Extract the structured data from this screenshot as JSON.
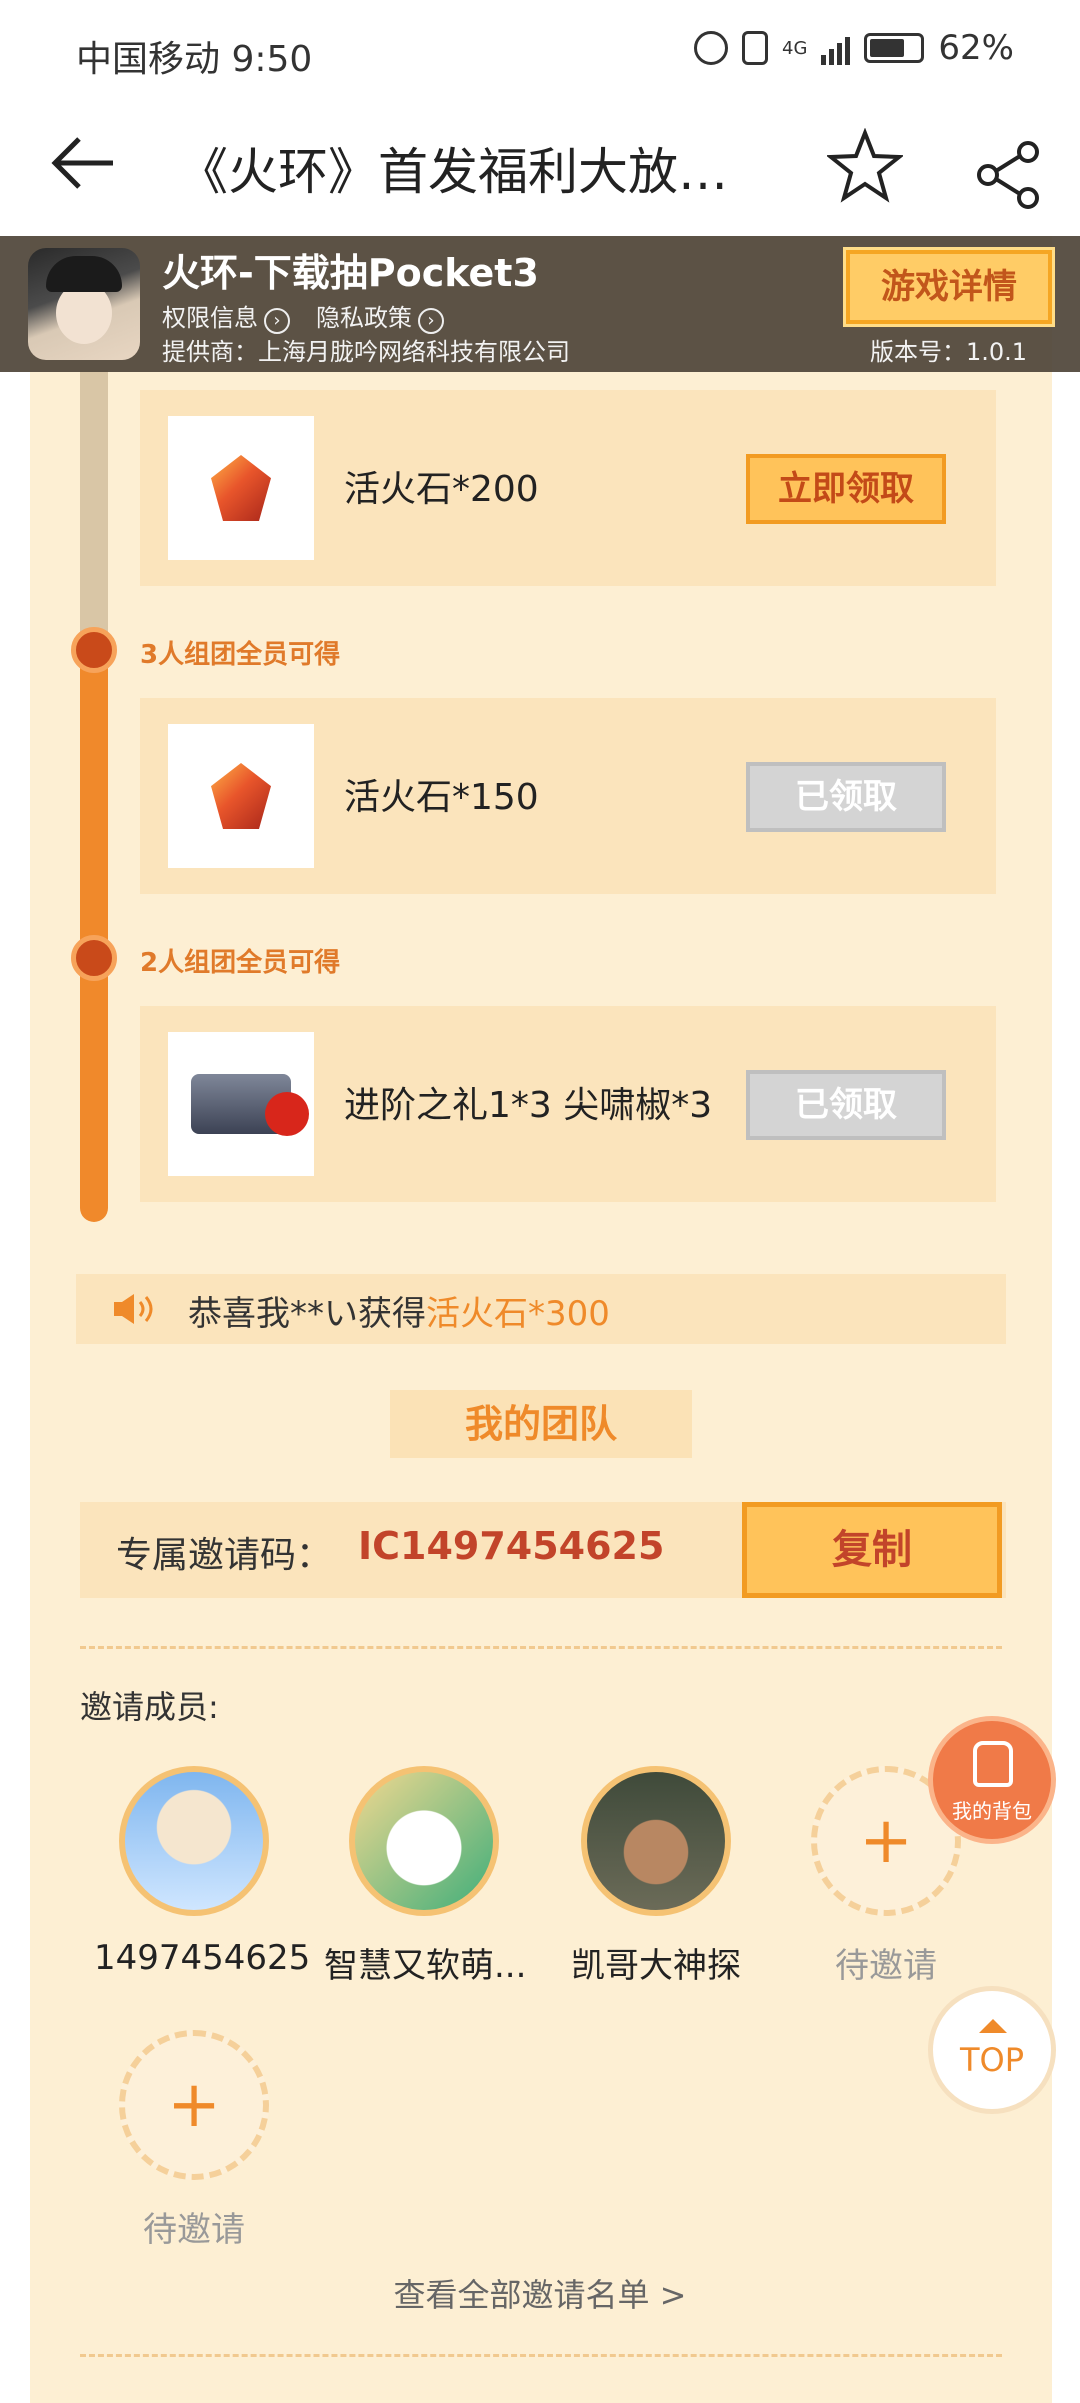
{
  "status_bar": {
    "carrier_time": "中国移动 9:50",
    "network": "4G",
    "battery": "62%"
  },
  "nav": {
    "title": "《火环》首发福利大放…"
  },
  "banner": {
    "game_name": "火环-下载抽Pocket3",
    "permission_link": "权限信息",
    "privacy_link": "隐私政策",
    "provider": "提供商：上海月胧吟网络科技有限公司",
    "detail_button": "游戏详情",
    "version": "版本号：1.0.1"
  },
  "rewards": [
    {
      "item": "活火石*200",
      "button": "立即领取",
      "state": "claimable"
    },
    {
      "tier": "3人组团全员可得",
      "item": "活火石*150",
      "button": "已领取",
      "state": "claimed"
    },
    {
      "tier": "2人组团全员可得",
      "item": "进阶之礼1*3   尖啸椒*3",
      "button": "已领取",
      "state": "claimed"
    }
  ],
  "broadcast": {
    "prefix": "恭喜我**い获得",
    "highlight": "活火石*300"
  },
  "team": {
    "title": "我的团队",
    "invite_label": "专属邀请码：",
    "invite_code": "IC1497454625",
    "copy_button": "复制",
    "members_title": "邀请成员:",
    "members": [
      {
        "name": "1497454625"
      },
      {
        "name": "智慧又软萌..."
      },
      {
        "name": "凯哥大神探"
      },
      {
        "name": "待邀请"
      },
      {
        "name": "待邀请"
      }
    ],
    "add_symbol": "+",
    "view_all": "查看全部邀请名单 >"
  },
  "floating": {
    "bag_label": "我的背包",
    "top_label": "TOP"
  }
}
